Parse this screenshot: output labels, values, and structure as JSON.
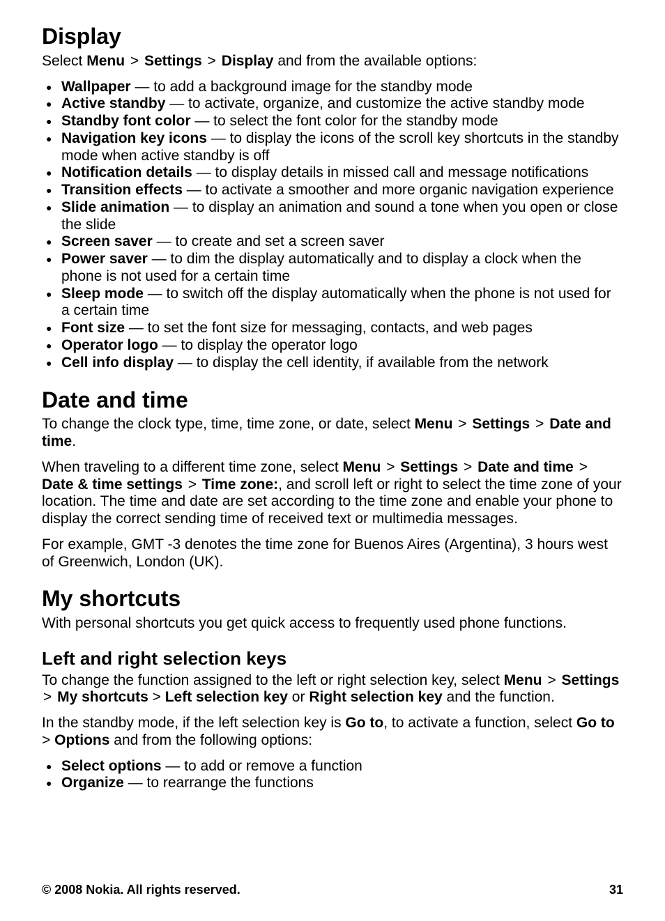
{
  "sections": {
    "display": {
      "heading": "Display",
      "intro": {
        "pre": "Select ",
        "path": [
          "Menu",
          "Settings",
          "Display"
        ],
        "post": " and from the available options:"
      },
      "items": [
        {
          "term": "Wallpaper",
          "desc": " — to add a background image for the standby mode"
        },
        {
          "term": "Active standby",
          "desc": " — to activate, organize, and customize the active standby mode"
        },
        {
          "term": "Standby font color",
          "desc": " — to select the font color for the standby mode"
        },
        {
          "term": "Navigation key icons",
          "desc": " — to display the icons of the scroll key shortcuts in the standby mode when active standby is off"
        },
        {
          "term": "Notification details",
          "desc": " — to display details in missed call and message notifications"
        },
        {
          "term": "Transition effects",
          "desc": " — to activate a smoother and more organic navigation experience"
        },
        {
          "term": "Slide animation",
          "desc": " — to display an animation and sound a tone when you open or close the slide"
        },
        {
          "term": "Screen saver",
          "desc": " — to create and set a screen saver"
        },
        {
          "term": "Power saver",
          "desc": " — to dim the display automatically and to display a clock when the phone is not used for a certain time"
        },
        {
          "term": "Sleep mode",
          "desc": " — to switch off the display automatically when the phone is not used for a certain time"
        },
        {
          "term": "Font size",
          "desc": " — to set the font size for messaging, contacts, and web pages"
        },
        {
          "term": "Operator logo",
          "desc": " — to display the operator logo"
        },
        {
          "term": "Cell info display",
          "desc": " — to display the cell identity, if available from the network"
        }
      ]
    },
    "datetime": {
      "heading": "Date and time",
      "p1": {
        "pre": "To change the clock type, time, time zone, or date, select ",
        "path": [
          "Menu",
          "Settings",
          "Date and time"
        ],
        "post": "."
      },
      "p2": {
        "pre": "When traveling to a different time zone, select ",
        "path": [
          "Menu",
          "Settings",
          "Date and time",
          "Date & time settings",
          "Time zone:"
        ],
        "post": ", and scroll left or right to select the time zone of your location. The time and date are set according to the time zone and enable your phone to display the correct sending time of received text or multimedia messages."
      },
      "p3": "For example, GMT -3 denotes the time zone for Buenos Aires (Argentina), 3 hours west of Greenwich, London (UK)."
    },
    "shortcuts": {
      "heading": "My shortcuts",
      "intro": "With personal shortcuts you get quick access to frequently used phone functions.",
      "sub": {
        "heading": "Left and right selection keys",
        "p1": {
          "pre": "To change the function assigned to the left or right selection key, select ",
          "path1": [
            "Menu",
            "Settings",
            "My shortcuts"
          ],
          "mid1": " > ",
          "opt1": "Left selection key",
          "or": " or ",
          "opt2": "Right selection key",
          "post": " and the function."
        },
        "p2": {
          "t1": "In the standby mode, if the left selection key is ",
          "b1": "Go to",
          "t2": ", to activate a function, select ",
          "b2": "Go to",
          "gt": " > ",
          "b3": "Options",
          "t3": " and from the following options:"
        },
        "items": [
          {
            "term": "Select options",
            "desc": " — to add or remove a function"
          },
          {
            "term": "Organize",
            "desc": " — to rearrange the functions"
          }
        ]
      }
    }
  },
  "footer": {
    "copyright": "© 2008 Nokia. All rights reserved.",
    "page": "31"
  },
  "sep": ">"
}
